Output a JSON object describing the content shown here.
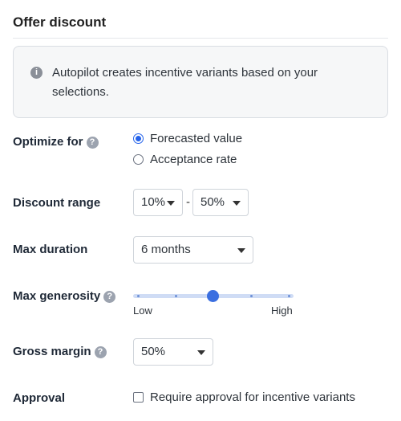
{
  "header": {
    "title": "Offer discount"
  },
  "info": {
    "icon": "info-icon",
    "text": "Autopilot creates incentive variants based on your selections."
  },
  "optimize": {
    "label": "Optimize for",
    "options": [
      {
        "label": "Forecasted value",
        "selected": true
      },
      {
        "label": "Acceptance rate",
        "selected": false
      }
    ]
  },
  "discount_range": {
    "label": "Discount range",
    "min": "10%",
    "separator": "-",
    "max": "50%"
  },
  "max_duration": {
    "label": "Max duration",
    "value": "6 months"
  },
  "max_generosity": {
    "label": "Max generosity",
    "low_label": "Low",
    "high_label": "High",
    "level": 0.5,
    "steps": 5
  },
  "gross_margin": {
    "label": "Gross margin",
    "value": "50%"
  },
  "approval": {
    "label": "Approval",
    "checkbox_label": "Require approval for incentive variants",
    "checked": false
  },
  "colors": {
    "accent": "#2563eb",
    "slider_fill": "#cfdcf5"
  }
}
